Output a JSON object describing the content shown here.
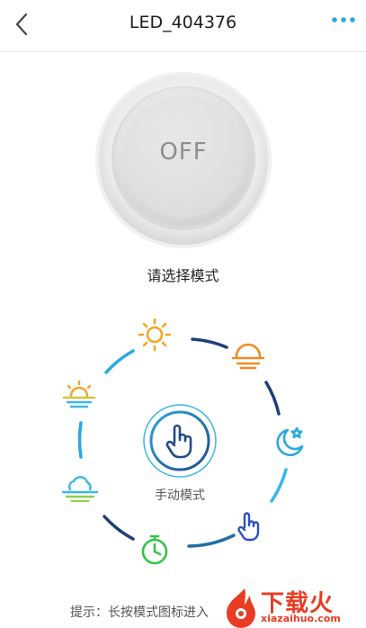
{
  "header": {
    "title": "LED_404376"
  },
  "power": {
    "state_label": "OFF"
  },
  "mode_prompt": "请选择模式",
  "center_mode": {
    "label": "手动模式",
    "icon": "hand-pointer-icon"
  },
  "modes": [
    {
      "icon": "sun-icon",
      "color": "#f5a623"
    },
    {
      "icon": "sunset-icon",
      "color": "#f08a24"
    },
    {
      "icon": "moon-star-icon",
      "color": "#2aa8e0"
    },
    {
      "icon": "hand-icon",
      "color": "#2c4fc4"
    },
    {
      "icon": "timer-icon",
      "color": "#36c24a"
    },
    {
      "icon": "cloud-icon",
      "color": "#8bd14a"
    },
    {
      "icon": "sunrise-icon",
      "color": "#d9c23a"
    }
  ],
  "hint": "提示：长按模式图标进入",
  "watermark": {
    "text": "下载火",
    "url": "xiazaihuo.com"
  }
}
